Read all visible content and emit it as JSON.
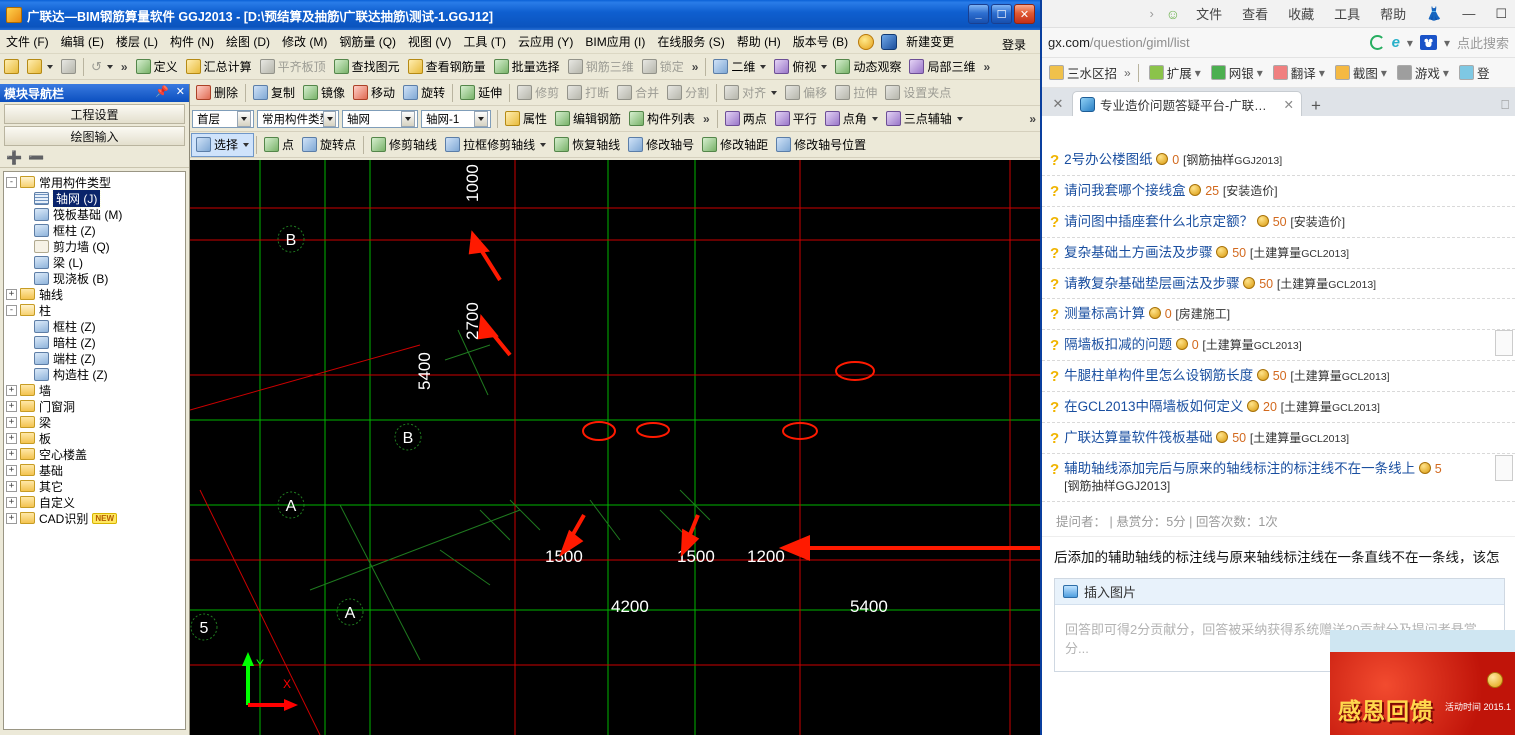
{
  "cad": {
    "title": "广联达—BIM钢筋算量软件  GGJ2013  -  [D:\\预结算及抽筋\\广联达抽筋\\测试-1.GGJ12]",
    "window_buttons": {
      "minimize": "_",
      "maximize": "☐",
      "close": "✕"
    },
    "menu": [
      "文件 (F)",
      "编辑 (E)",
      "楼层 (L)",
      "构件 (N)",
      "绘图 (D)",
      "修改 (M)",
      "钢筋量 (Q)",
      "视图 (V)",
      "工具 (T)",
      "云应用 (Y)",
      "BIM应用 (I)",
      "在线服务 (S)",
      "帮助 (H)",
      "版本号 (B)"
    ],
    "menu_extra": "新建变更",
    "login_label": "登录",
    "toolbar1": [
      {
        "label": "定义",
        "disabled": false
      },
      {
        "label": "汇总计算",
        "disabled": false
      },
      {
        "label": "平齐板顶",
        "disabled": true
      },
      {
        "label": "查找图元",
        "disabled": false
      },
      {
        "label": "查看钢筋量",
        "disabled": false
      },
      {
        "label": "批量选择",
        "disabled": false
      },
      {
        "label": "钢筋三维",
        "disabled": true
      },
      {
        "label": "锁定",
        "disabled": true
      }
    ],
    "toolbar1_right": [
      {
        "label": "二维",
        "dropdown": true
      },
      {
        "label": "俯视",
        "dropdown": true
      },
      {
        "label": "动态观察",
        "dropdown": false
      },
      {
        "label": "局部三维",
        "dropdown": false
      }
    ],
    "toolbar2": [
      {
        "label": "删除",
        "disabled": false
      },
      {
        "label": "复制",
        "disabled": false
      },
      {
        "label": "镜像",
        "disabled": false
      },
      {
        "label": "移动",
        "disabled": false
      },
      {
        "label": "旋转",
        "disabled": false
      },
      {
        "label": "延伸",
        "disabled": false
      },
      {
        "label": "修剪",
        "disabled": true
      },
      {
        "label": "打断",
        "disabled": true
      },
      {
        "label": "合并",
        "disabled": true
      },
      {
        "label": "分割",
        "disabled": true
      },
      {
        "label": "对齐",
        "disabled": true,
        "dropdown": true
      },
      {
        "label": "偏移",
        "disabled": true
      },
      {
        "label": "拉伸",
        "disabled": true
      },
      {
        "label": "设置夹点",
        "disabled": true
      }
    ],
    "toolbar3_combos": [
      {
        "name": "floor-select",
        "value": "首层"
      },
      {
        "name": "component-group-select",
        "value": "常用构件类型"
      },
      {
        "name": "component-type-select",
        "value": "轴网"
      },
      {
        "name": "component-instance-select",
        "value": "轴网-1"
      }
    ],
    "toolbar3": [
      {
        "label": "属性",
        "disabled": false
      },
      {
        "label": "编辑钢筋",
        "disabled": false
      },
      {
        "label": "构件列表",
        "disabled": false
      },
      {
        "label": "两点",
        "disabled": false
      },
      {
        "label": "平行",
        "disabled": false
      },
      {
        "label": "点角",
        "disabled": false,
        "dropdown": true
      },
      {
        "label": "三点辅轴",
        "disabled": false,
        "dropdown": true
      }
    ],
    "toolbar4": [
      {
        "label": "选择",
        "disabled": false,
        "dropdown": true,
        "active": true
      },
      {
        "label": "点",
        "disabled": false
      },
      {
        "label": "旋转点",
        "disabled": false
      },
      {
        "label": "修剪轴线",
        "disabled": false
      },
      {
        "label": "拉框修剪轴线",
        "disabled": false,
        "dropdown": true
      },
      {
        "label": "恢复轴线",
        "disabled": false
      },
      {
        "label": "修改轴号",
        "disabled": false
      },
      {
        "label": "修改轴距",
        "disabled": false
      },
      {
        "label": "修改轴号位置",
        "disabled": false
      }
    ],
    "nav": {
      "title": "模块导航栏",
      "pin_icon": "pin-icon",
      "close_icon": "close-icon",
      "buttons": [
        "工程设置",
        "绘图输入"
      ],
      "tools": [
        "expand-all-icon",
        "collapse-all-icon"
      ],
      "tree": [
        {
          "depth": 0,
          "tog": "-",
          "icon": "folder-open",
          "label": "常用构件类型",
          "selected": false
        },
        {
          "depth": 1,
          "tog": "",
          "icon": "grid",
          "label": "轴网 (J)",
          "selected": true
        },
        {
          "depth": 1,
          "tog": "",
          "icon": "comp",
          "label": "筏板基础 (M)",
          "selected": false
        },
        {
          "depth": 1,
          "tog": "",
          "icon": "comp",
          "label": "框柱 (Z)",
          "selected": false
        },
        {
          "depth": 1,
          "tog": "",
          "icon": "dot",
          "label": "剪力墙 (Q)",
          "selected": false
        },
        {
          "depth": 1,
          "tog": "",
          "icon": "comp",
          "label": "梁 (L)",
          "selected": false
        },
        {
          "depth": 1,
          "tog": "",
          "icon": "comp",
          "label": "现浇板 (B)",
          "selected": false
        },
        {
          "depth": 0,
          "tog": "+",
          "icon": "folder",
          "label": "轴线",
          "selected": false
        },
        {
          "depth": 0,
          "tog": "-",
          "icon": "folder-open",
          "label": "柱",
          "selected": false
        },
        {
          "depth": 1,
          "tog": "",
          "icon": "comp",
          "label": "框柱 (Z)",
          "selected": false
        },
        {
          "depth": 1,
          "tog": "",
          "icon": "comp",
          "label": "暗柱 (Z)",
          "selected": false
        },
        {
          "depth": 1,
          "tog": "",
          "icon": "comp",
          "label": "端柱 (Z)",
          "selected": false
        },
        {
          "depth": 1,
          "tog": "",
          "icon": "comp",
          "label": "构造柱 (Z)",
          "selected": false
        },
        {
          "depth": 0,
          "tog": "+",
          "icon": "folder",
          "label": "墙",
          "selected": false
        },
        {
          "depth": 0,
          "tog": "+",
          "icon": "folder",
          "label": "门窗洞",
          "selected": false
        },
        {
          "depth": 0,
          "tog": "+",
          "icon": "folder",
          "label": "梁",
          "selected": false
        },
        {
          "depth": 0,
          "tog": "+",
          "icon": "folder",
          "label": "板",
          "selected": false
        },
        {
          "depth": 0,
          "tog": "+",
          "icon": "folder",
          "label": "空心楼盖",
          "selected": false
        },
        {
          "depth": 0,
          "tog": "+",
          "icon": "folder",
          "label": "基础",
          "selected": false
        },
        {
          "depth": 0,
          "tog": "+",
          "icon": "folder",
          "label": "其它",
          "selected": false
        },
        {
          "depth": 0,
          "tog": "+",
          "icon": "folder",
          "label": "自定义",
          "selected": false
        },
        {
          "depth": 0,
          "tog": "+",
          "icon": "folder",
          "label": "CAD识别",
          "selected": false,
          "badge": "NEW"
        }
      ]
    },
    "canvas": {
      "background": "#000000",
      "grid_color_green": "#00b400",
      "grid_color_red": "#d00000",
      "axis_labels": [
        "B",
        "B",
        "A",
        "A",
        "5"
      ],
      "dimensions_vertical": [
        "1000",
        "2700",
        "5400"
      ],
      "dimensions_horizontal": [
        "1500",
        "1500",
        "1200",
        "4200",
        "5400"
      ],
      "ucs": {
        "x_label": "X",
        "y_label": "Y"
      },
      "annotation_color": "#ff0000"
    }
  },
  "browser": {
    "menu": [
      "文件",
      "查看",
      "收藏",
      "工具",
      "帮助"
    ],
    "user_icon": "person-icon",
    "skin_icon": "shirt-icon",
    "window_buttons": {
      "minimize": "—",
      "maximize": "☐",
      "close": "✕"
    },
    "address": {
      "domain": "gx.com",
      "path": "/question/giml/list"
    },
    "address_icons": [
      "refresh-icon",
      "compat-view-icon",
      "chevron-down-icon"
    ],
    "search_engine_icon": "baidu-paw-icon",
    "search_placeholder": "点此搜索",
    "bookmarks": [
      {
        "label": "三水区招",
        "icon": "bookmark-icon"
      },
      {
        "label": "扩展",
        "icon": "extensions-icon",
        "dropdown": true
      },
      {
        "label": "网银",
        "icon": "bank-icon",
        "dropdown": true
      },
      {
        "label": "翻译",
        "icon": "translate-icon",
        "dropdown": true
      },
      {
        "label": "截图",
        "icon": "screenshot-icon",
        "dropdown": true
      },
      {
        "label": "游戏",
        "icon": "game-icon",
        "dropdown": true
      },
      {
        "label": "登",
        "icon": "login-icon",
        "dropdown": false
      }
    ],
    "tab": {
      "title": "专业造价问题答疑平台-广联达服",
      "close": "✕"
    },
    "new_tab": "+",
    "questions": [
      {
        "title": "2号办公楼图纸",
        "points": "0",
        "category": "[钢筋抽样",
        "category_sm": "GGJ2013]"
      },
      {
        "title": "请问我套哪个接线盒",
        "points": "25",
        "category": "[安装造价]",
        "category_sm": ""
      },
      {
        "title": "请问图中插座套什么北京定额？",
        "points": "50",
        "category": "[安装造价]",
        "category_sm": ""
      },
      {
        "title": "复杂基础土方画法及步骤",
        "points": "50",
        "category": "[土建算量",
        "category_sm": "GCL2013]"
      },
      {
        "title": "请教复杂基础垫层画法及步骤",
        "points": "50",
        "category": "[土建算量",
        "category_sm": "GCL2013]"
      },
      {
        "title": "测量标高计算",
        "points": "0",
        "category": "[房建施工]",
        "category_sm": ""
      },
      {
        "title": "隔墙板扣减的问题",
        "points": "0",
        "category": "[土建算量",
        "category_sm": "GCL2013]"
      },
      {
        "title": "牛腿柱单构件里怎么设钢筋长度",
        "points": "50",
        "category": "[土建算量",
        "category_sm": "GCL2013]"
      },
      {
        "title": "在GCL2013中隔墙板如何定义",
        "points": "20",
        "category": "[土建算量",
        "category_sm": "GCL2013]"
      },
      {
        "title": "广联达算量软件筏板基础",
        "points": "50",
        "category": "[土建算量",
        "category_sm": "GCL2013]"
      },
      {
        "title": "辅助轴线添加完后与原来的轴线标注的标注线不在一条线上",
        "points": "5",
        "category": "",
        "category_sm": ""
      }
    ],
    "current_question_category": "[钢筋抽样GGJ2013]",
    "meta": "提问者：    |    悬赏分：5分    |    回答次数：1次",
    "question_body": "后添加的辅助轴线的标注线与原来轴线标注线在一条直线不在一条线，该怎",
    "answer_box": {
      "insert_image_label": "插入图片",
      "placeholder": "回答即可得2分贡献分，回答被采纳获得系统赠送20贡献分及提问者悬赏分..."
    },
    "promo": {
      "headline": "感恩回馈",
      "sub": "活动时间\n2015.1"
    }
  }
}
